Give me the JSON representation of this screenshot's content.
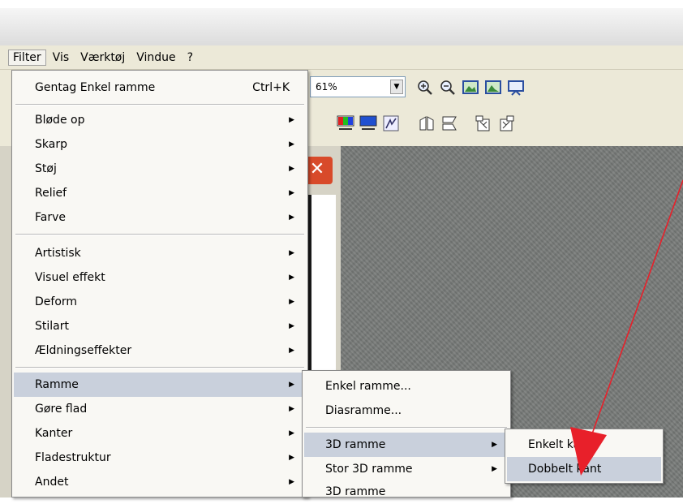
{
  "menubar": {
    "items": [
      "Filter",
      "Vis",
      "Værktøj",
      "Vindue",
      "?"
    ]
  },
  "toolbar": {
    "zoom_value": "61%"
  },
  "filter_menu": {
    "repeat_label": "Gentag Enkel ramme",
    "repeat_shortcut": "Ctrl+K",
    "group1": [
      "Bløde op",
      "Skarp",
      "Støj",
      "Relief",
      "Farve"
    ],
    "group2": [
      "Artistisk",
      "Visuel effekt",
      "Deform",
      "Stilart",
      "Ældningseffekter"
    ],
    "group3": [
      "Ramme",
      "Gøre flad",
      "Kanter",
      "Fladestruktur",
      "Andet"
    ]
  },
  "ramme_menu": {
    "items": [
      "Enkel ramme...",
      "Diasramme...",
      "3D ramme",
      "Stor 3D ramme",
      "3D ramme"
    ]
  },
  "ramme3d_menu": {
    "items": [
      "Enkelt kant",
      "Dobbelt kant"
    ]
  },
  "colors": {
    "menubar_bg": "#ece9d8",
    "menu_bg": "#f9f8f4",
    "highlight": "#c9d0dc",
    "annotation_arrow": "#e8202a"
  }
}
